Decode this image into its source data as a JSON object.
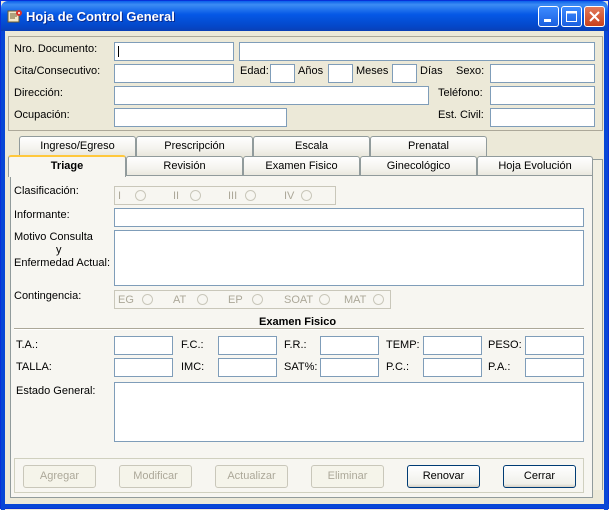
{
  "window": {
    "title": "Hoja de Control General"
  },
  "header": {
    "nro_documento": "Nro. Documento:",
    "cita": "Cita/Consecutivo:",
    "edad": "Edad:",
    "anos": "Años",
    "meses": "Meses",
    "dias": "Días",
    "sexo": "Sexo:",
    "direccion": "Dirección:",
    "telefono": "Teléfono:",
    "ocupacion": "Ocupación:",
    "est_civil": "Est. Civil:"
  },
  "tabs_back": [
    "Ingreso/Egreso",
    "Prescripción",
    "Escala",
    "Prenatal"
  ],
  "tabs_front": [
    "Triage",
    "Revisión",
    "Examen Fisico",
    "Ginecológico",
    "Hoja Evolución"
  ],
  "triage": {
    "clasificacion": "Clasificación:",
    "clasif_options": [
      "I",
      "II",
      "III",
      "IV"
    ],
    "informante": "Informante:",
    "motivo_1": "Motivo Consulta",
    "motivo_2": "y",
    "motivo_3": "Enfermedad Actual:",
    "contingencia": "Contingencia:",
    "contingencia_options": [
      "EG",
      "AT",
      "EP",
      "SOAT",
      "MAT"
    ],
    "examen_title": "Examen Fisico",
    "ta": "T.A.:",
    "fc": "F.C.:",
    "fr": "F.R.:",
    "temp": "TEMP:",
    "peso": "PESO:",
    "talla": "TALLA:",
    "imc": "IMC:",
    "sat": "SAT%:",
    "pc": "P.C.:",
    "pa": "P.A.:",
    "estado": "Estado General:"
  },
  "buttons": {
    "agregar": "Agregar",
    "modificar": "Modificar",
    "actualizar": "Actualizar",
    "eliminar": "Eliminar",
    "renovar": "Renovar",
    "cerrar": "Cerrar"
  }
}
